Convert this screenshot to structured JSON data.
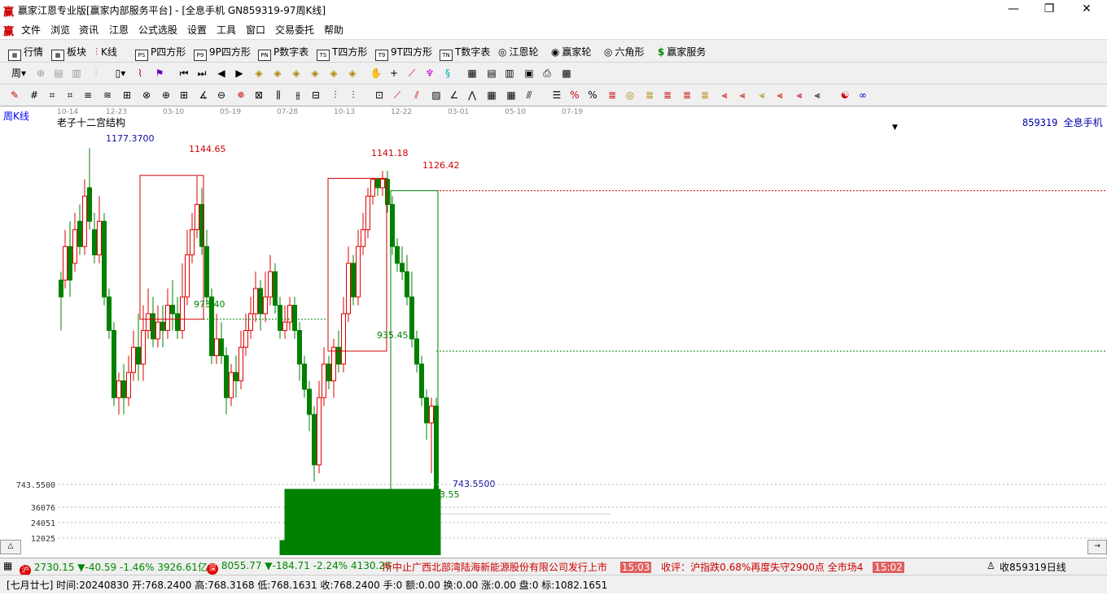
{
  "window": {
    "title": "赢家江恩专业版[赢家内部服务平台] - [全息手机  GN859319-97周K线]",
    "logo": "赢",
    "min": "—",
    "max": "❐",
    "close": "✕"
  },
  "menu": [
    "文件",
    "浏览",
    "资讯",
    "江恩",
    "公式选股",
    "设置",
    "工具",
    "窗口",
    "交易委托",
    "帮助"
  ],
  "toolbar1": [
    {
      "icon": "grid-icon",
      "label": "行情"
    },
    {
      "icon": "blocks-icon",
      "label": "板块"
    },
    {
      "icon": "kline-icon",
      "label": "K线"
    },
    {
      "icon": "ps-icon",
      "label": "P四方形",
      "badge": "PS"
    },
    {
      "icon": "9p-icon",
      "label": "9P四方形",
      "badge": "P9"
    },
    {
      "icon": "pn-icon",
      "label": "P数字表",
      "badge": "PN"
    },
    {
      "icon": "ts-icon",
      "label": "T四方形",
      "badge": "TS"
    },
    {
      "icon": "t9-icon",
      "label": "9T四方形",
      "badge": "T9"
    },
    {
      "icon": "tn-icon",
      "label": "T数字表",
      "badge": "TN"
    },
    {
      "icon": "gann-wheel-icon",
      "label": "江恩轮"
    },
    {
      "icon": "winner-wheel-icon",
      "label": "赢家轮"
    },
    {
      "icon": "hexagon-icon",
      "label": "六角形"
    },
    {
      "icon": "dollar-icon",
      "label": "赢家服务"
    }
  ],
  "chart": {
    "period_label": "周K线",
    "indicator_label": "老子十二宫结构",
    "stock_label": "859319 全息手机",
    "time_axis": [
      "10-14",
      "12-23",
      "03-10",
      "05-19",
      "07-28",
      "10-13",
      "12-22",
      "03-01",
      "05-10",
      "07-19"
    ],
    "annotations": {
      "high1": "1177.3700",
      "box1_high": "1144.65",
      "box1_low": "973.40",
      "box2_high": "1141.18",
      "box3_high": "1126.42",
      "box3_low": "935.45",
      "low": "743.5500",
      "low2": "743.55"
    },
    "volume_axis": [
      "743.5500",
      "36076",
      "24051",
      "12025"
    ],
    "colors": {
      "up": "#e00000",
      "down": "#008000",
      "box": "#d00000",
      "box_green": "#008000",
      "label_blue": "#1010a0"
    }
  },
  "status1": {
    "idx1_value": "2730.15",
    "idx1_change": "▼-40.59",
    "idx1_pct": "-1.46%",
    "idx1_amount": "3926.61亿",
    "idx2_value": "8055.77",
    "idx2_change": "▼-184.71",
    "idx2_pct": "-2.24%",
    "idx2_amount": "4130.26",
    "news1": "所中止广西北部湾陆海新能源股份有限公司发行上市",
    "news1_time": "15:03",
    "news2": "收评：沪指跌0.68%再度失守2900点 全市场4",
    "news2_time": "15:02",
    "right_text": "收859319日线",
    "badge1": "沪",
    "badge2": "深"
  },
  "status2": {
    "text": "[七月廿七] 时间:20240830 开:768.2400 高:768.3168 低:768.1631 收:768.2400 手:0 额:0.00 换:0.00 涨:0.00 盘:0 标:1082.1651"
  }
}
